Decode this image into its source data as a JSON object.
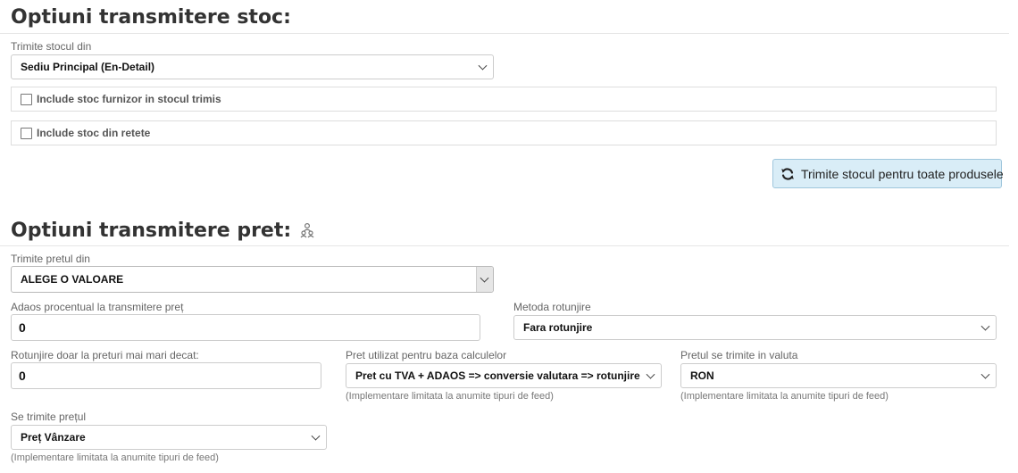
{
  "stock": {
    "title": "Optiuni transmitere stoc:",
    "source_label": "Trimite stocul din",
    "source_value": "Sediu Principal (En-Detail)",
    "supplier_checkbox_label": "Include stoc furnizor in stocul trimis",
    "recipes_checkbox_label": "Include stoc din retete",
    "send_button_label": "Trimite stocul pentru toate produsele"
  },
  "price": {
    "title": "Optiuni transmitere pret:",
    "source_label": "Trimite pretul din",
    "source_value": "ALEGE O VALOARE",
    "markup_label": "Adaos procentual la transmitere preț",
    "markup_value": "0",
    "rounding_method_label": "Metoda rotunjire",
    "rounding_method_value": "Fara rotunjire",
    "rounding_threshold_label": "Rotunjire doar la preturi mai mari decat:",
    "rounding_threshold_value": "0",
    "calc_base_label": "Pret utilizat pentru baza calculelor",
    "calc_base_value": "Pret cu TVA + ADAOS => conversie valutara => rotunjire",
    "calc_base_hint": "(Implementare limitata la anumite tipuri de feed)",
    "currency_label": "Pretul se trimite in valuta",
    "currency_value": "RON",
    "currency_hint": "(Implementare limitata la anumite tipuri de feed)",
    "price_type_label": "Se trimite prețul",
    "price_type_value": "Preț Vânzare",
    "price_type_hint": "(Implementare limitata la anumite tipuri de feed)"
  },
  "icons": {
    "refresh": "refresh-icon",
    "settings": "users-settings-icon"
  }
}
